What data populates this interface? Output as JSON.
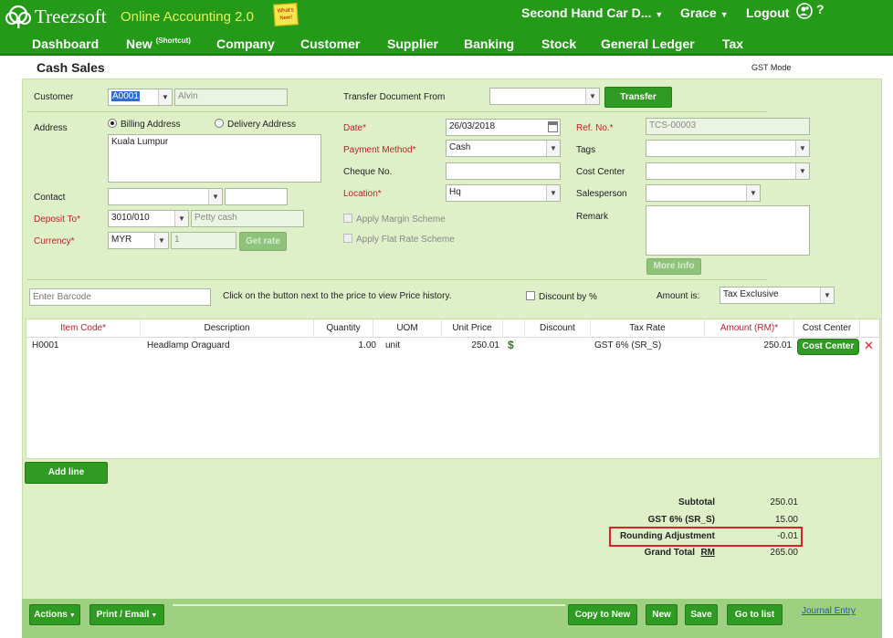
{
  "header": {
    "brand": "Treezsoft",
    "brand_sub": "Online Accounting 2.0",
    "whats_new": "What's New!",
    "company": "Second Hand Car D...",
    "user": "Grace",
    "logout": "Logout",
    "help": "?"
  },
  "nav": {
    "dashboard": "Dashboard",
    "new": "New",
    "new_shortcut": "(Shortcut)",
    "company": "Company",
    "customer": "Customer",
    "supplier": "Supplier",
    "banking": "Banking",
    "stock": "Stock",
    "general_ledger": "General Ledger",
    "tax": "Tax"
  },
  "page": {
    "title": "Cash Sales",
    "gst_mode": "GST Mode"
  },
  "form": {
    "customer_label": "Customer",
    "customer_code": "A0001",
    "customer_name": "Alvin",
    "transfer_label": "Transfer Document From",
    "transfer_value": "",
    "transfer_button": "Transfer",
    "address_label": "Address",
    "billing_address": "Billing Address",
    "delivery_address": "Delivery Address",
    "address_value": "Kuala Lumpur",
    "contact_label": "Contact",
    "contact_value": "",
    "contact_phone": "",
    "deposit_label": "Deposit To*",
    "deposit_code": "3010/010",
    "deposit_name": "Petty cash",
    "currency_label": "Currency*",
    "currency_value": "MYR",
    "currency_rate": "1",
    "get_rate": "Get rate",
    "date_label": "Date*",
    "date_value": "26/03/2018",
    "payment_label": "Payment Method*",
    "payment_value": "Cash",
    "cheque_label": "Cheque No.",
    "cheque_value": "",
    "location_label": "Location*",
    "location_value": "Hq",
    "margin_scheme": "Apply Margin Scheme",
    "flat_rate": "Apply Flat Rate Scheme",
    "ref_label": "Ref. No.*",
    "ref_value": "TCS-00003",
    "tags_label": "Tags",
    "cost_center_label": "Cost Center",
    "salesperson_label": "Salesperson",
    "remark_label": "Remark",
    "more_info": "More Info",
    "barcode_placeholder": "Enter Barcode",
    "price_hint": "Click on the button next to the price to view Price history.",
    "discount_pct": "Discount by %",
    "amount_is_label": "Amount is:",
    "amount_is_value": "Tax Exclusive"
  },
  "table": {
    "headers": {
      "item_code": "Item Code*",
      "description": "Description",
      "quantity": "Quantity",
      "uom": "UOM",
      "unit_price": "Unit Price",
      "discount": "Discount",
      "tax_rate": "Tax Rate",
      "amount": "Amount (RM)*",
      "cost_center": "Cost Center"
    },
    "rows": [
      {
        "item_code": "H0001",
        "description": "Headlamp Oraguard",
        "quantity": "1.00",
        "uom": "unit",
        "unit_price": "250.01",
        "discount": "",
        "tax_rate": "GST 6% (SR_S)",
        "amount": "250.01",
        "cost_center_button": "Cost Center"
      }
    ],
    "add_line": "Add line"
  },
  "totals": {
    "subtotal_label": "Subtotal",
    "subtotal": "250.01",
    "gst_label": "GST 6% (SR_S)",
    "gst": "15.00",
    "rounding_label": "Rounding Adjustment",
    "rounding": "-0.01",
    "grand_label": "Grand Total",
    "currency": "RM",
    "grand": "265.00"
  },
  "footer": {
    "actions": "Actions",
    "print_email": "Print / Email",
    "copy_to_new": "Copy to New",
    "new": "New",
    "save": "Save",
    "go_to_list": "Go to list",
    "journal_entry": "Journal Entry"
  },
  "colors": {
    "brand_green": "#249a18",
    "panel_bg": "#dff0c8",
    "required_red": "#c0202a",
    "highlight_red": "#d9232a"
  }
}
